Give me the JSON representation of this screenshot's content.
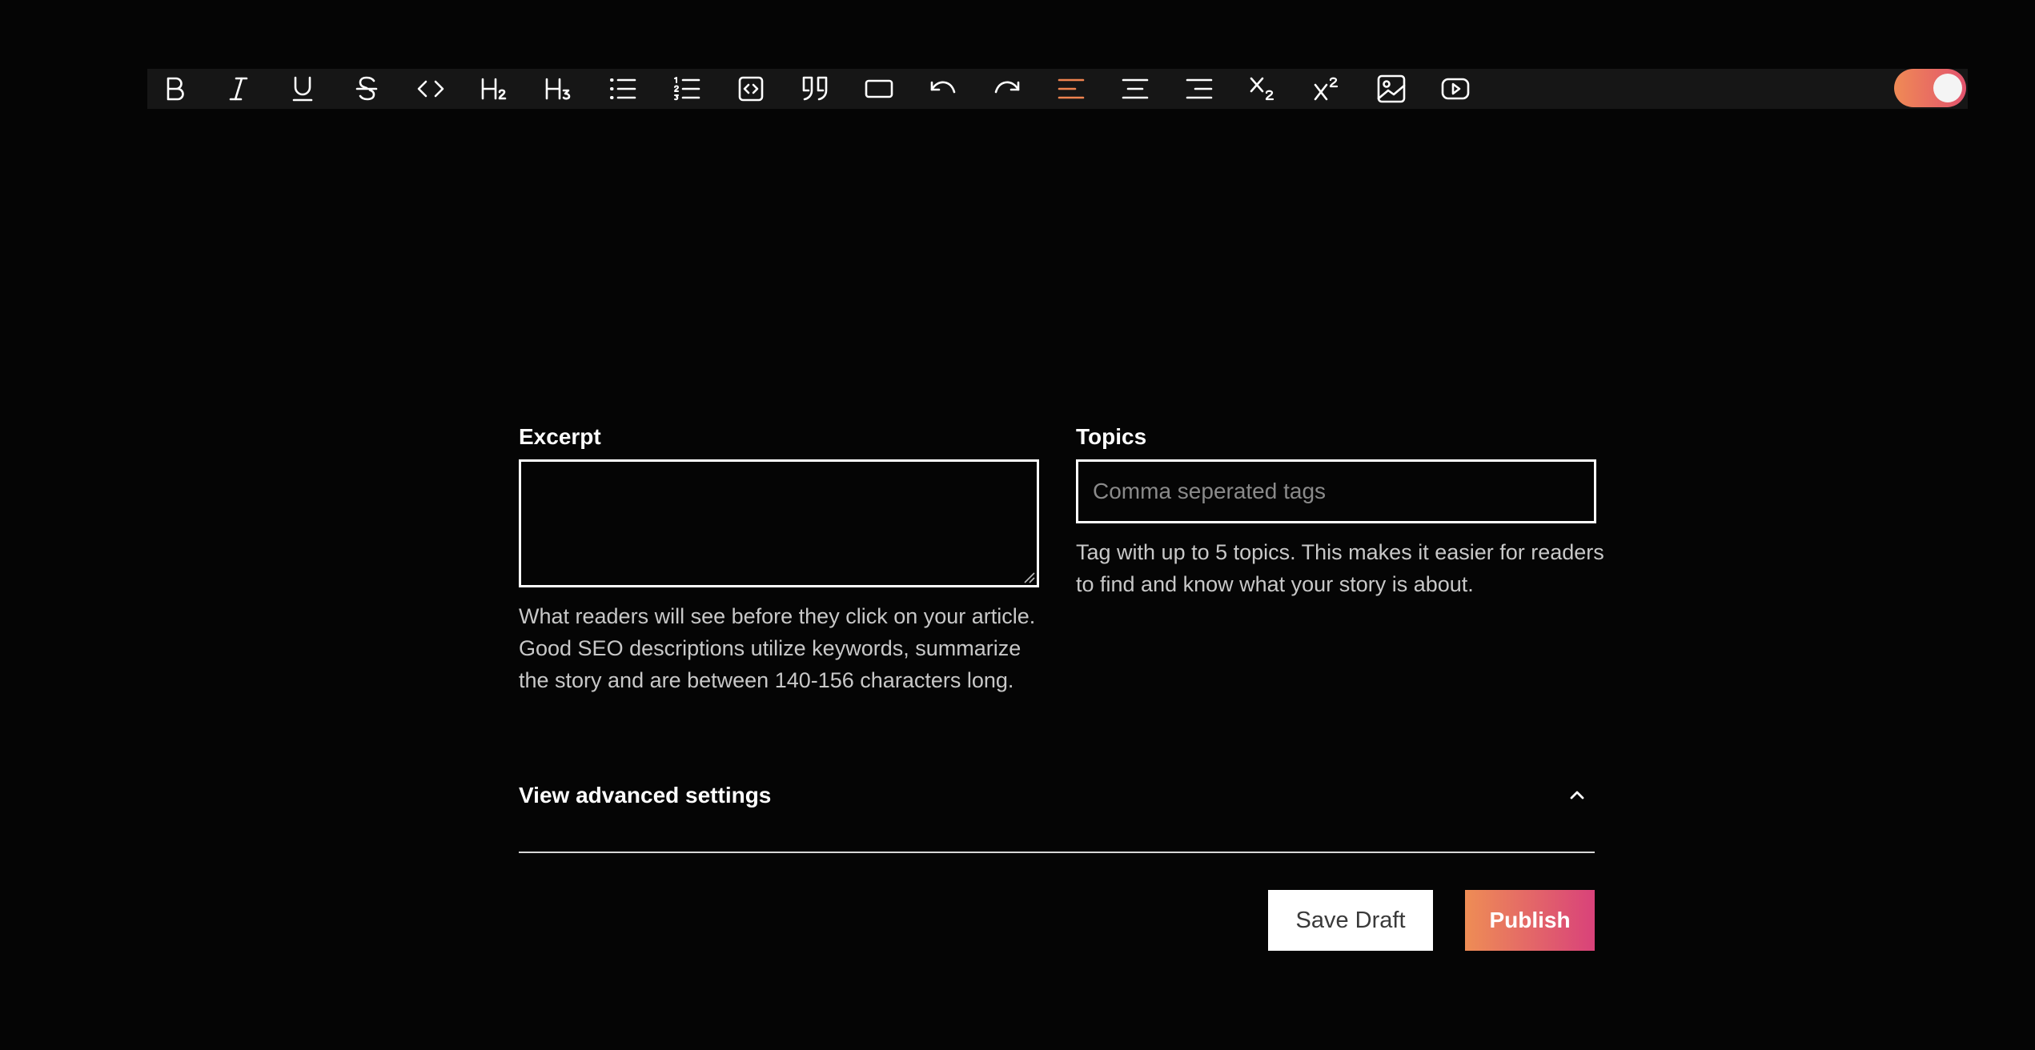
{
  "toolbar": {
    "buttons": [
      {
        "icon": "bold-icon"
      },
      {
        "icon": "italic-icon"
      },
      {
        "icon": "underline-icon"
      },
      {
        "icon": "strikethrough-icon"
      },
      {
        "icon": "code-icon"
      },
      {
        "icon": "heading-2-icon",
        "text": "H2"
      },
      {
        "icon": "heading-3-icon",
        "text": "H3"
      },
      {
        "icon": "bullet-list-icon"
      },
      {
        "icon": "ordered-list-icon"
      },
      {
        "icon": "code-block-icon"
      },
      {
        "icon": "blockquote-icon"
      },
      {
        "icon": "horizontal-rule-icon"
      },
      {
        "icon": "undo-icon"
      },
      {
        "icon": "redo-icon"
      },
      {
        "icon": "align-left-icon",
        "active": true
      },
      {
        "icon": "align-center-icon"
      },
      {
        "icon": "align-right-icon"
      },
      {
        "icon": "subscript-icon"
      },
      {
        "icon": "superscript-icon"
      },
      {
        "icon": "image-icon"
      },
      {
        "icon": "video-icon"
      }
    ],
    "active_color": "#ef8350",
    "toggle_on": true
  },
  "excerpt": {
    "label": "Excerpt",
    "value": "",
    "help": "What readers will see before they click on your article. Good SEO descriptions utilize keywords, summarize the story and are between 140-156 characters long."
  },
  "topics": {
    "label": "Topics",
    "value": "",
    "placeholder": "Comma seperated tags",
    "help": "Tag with up to 5 topics. This makes it easier for readers to find and know what your story is about."
  },
  "advanced": {
    "label": "View advanced settings"
  },
  "actions": {
    "save_draft": "Save Draft",
    "publish": "Publish"
  },
  "colors": {
    "accent_start": "#ee8d55",
    "accent_end": "#d9427a",
    "background": "#050505"
  }
}
